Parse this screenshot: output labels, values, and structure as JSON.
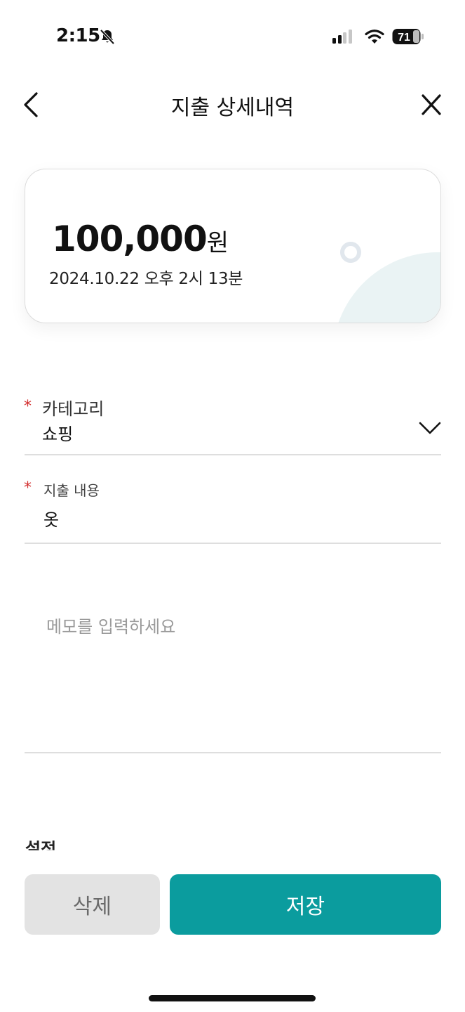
{
  "status_bar": {
    "time": "2:15",
    "battery": "71"
  },
  "nav": {
    "title": "지출 상세내역"
  },
  "summary": {
    "amount": "100,000",
    "currency_unit": "원",
    "datetime": "2024.10.22 오후 2시 13분"
  },
  "form": {
    "category": {
      "required_mark": "*",
      "label": "카테고리",
      "value": "쇼핑"
    },
    "description": {
      "required_mark": "*",
      "label": "지출 내용",
      "value": "옷"
    },
    "memo": {
      "placeholder": "메모를 입력하세요"
    },
    "next_section_label": "설정"
  },
  "actions": {
    "delete_label": "삭제",
    "save_label": "저장"
  },
  "colors": {
    "accent": "#0b9c9e",
    "required": "#d32f2f",
    "delete_bg": "#e3e3e3"
  }
}
